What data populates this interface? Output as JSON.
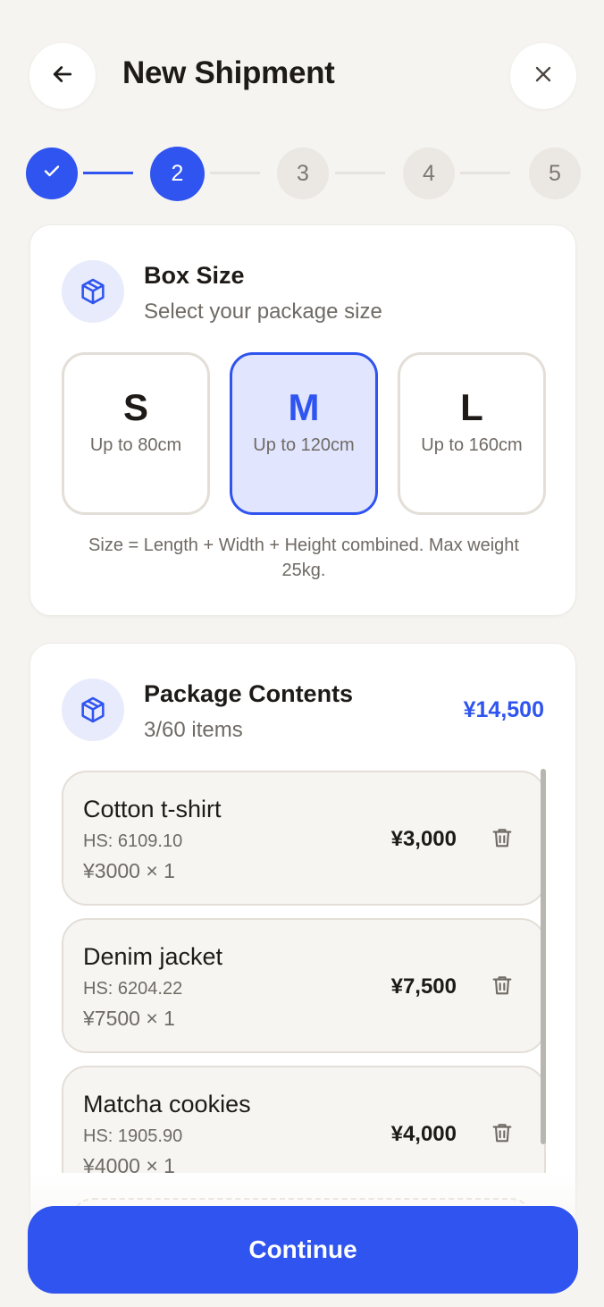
{
  "header": {
    "title": "New Shipment",
    "back_icon": "arrow-left-icon",
    "close_icon": "close-icon"
  },
  "stepper": {
    "current": 2,
    "steps": [
      "1",
      "2",
      "3",
      "4",
      "5"
    ]
  },
  "box_size": {
    "title": "Box Size",
    "subtitle": "Select your package size",
    "icon": "box-icon",
    "selected": "M",
    "options": [
      {
        "letter": "S",
        "desc": "Up to 80cm"
      },
      {
        "letter": "M",
        "desc": "Up to 120cm"
      },
      {
        "letter": "L",
        "desc": "Up to 160cm"
      }
    ],
    "note": "Size = Length + Width + Height combined. Max weight 25kg."
  },
  "contents": {
    "title": "Package Contents",
    "count": "3/60 items",
    "total": "¥14,500",
    "icon": "box-icon",
    "items": [
      {
        "name": "Cotton t-shirt",
        "hs": "HS: 6109.10",
        "qty": "¥3000 × 1",
        "price": "¥3,000"
      },
      {
        "name": "Denim jacket",
        "hs": "HS: 6204.22",
        "qty": "¥7500 × 1",
        "price": "¥7,500"
      },
      {
        "name": "Matcha cookies",
        "hs": "HS: 1905.90",
        "qty": "¥4000 × 1",
        "price": "¥4,000"
      }
    ]
  },
  "footer": {
    "continue_label": "Continue"
  },
  "colors": {
    "accent": "#2f54ef",
    "accent_light": "#e1e5fd",
    "background": "#f6f4f1"
  }
}
